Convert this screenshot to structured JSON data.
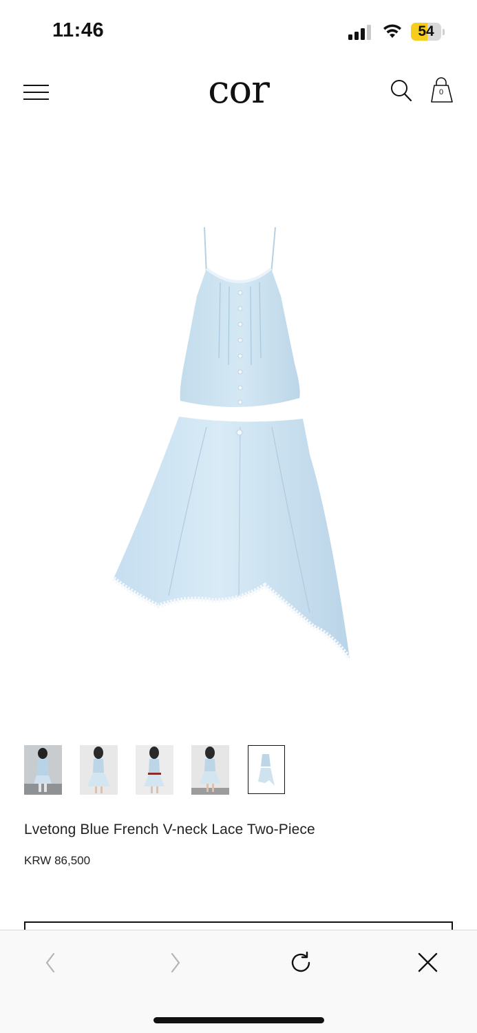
{
  "status_bar": {
    "time": "11:46",
    "battery_level": "54",
    "battery_percent": 54,
    "battery_color": "#f4cd1d"
  },
  "header": {
    "logo": "cor",
    "icons": [
      "menu-icon",
      "search-icon",
      "shopping-bag-icon"
    ],
    "cart_count": "0"
  },
  "product": {
    "title": "Lvetong Blue French V-neck Lace Two-Piece",
    "price": "KRW 86,500",
    "thumbnail_count": 5,
    "active_thumbnail": 5,
    "garment_color": "#c9e2f1"
  },
  "browser_toolbar": {
    "icons": [
      "back-arrow-icon",
      "forward-arrow-icon",
      "reload-icon",
      "close-icon"
    ]
  }
}
